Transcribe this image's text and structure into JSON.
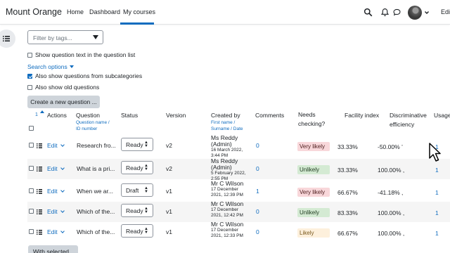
{
  "nav": {
    "brand": "Mount Orange",
    "links": [
      "Home",
      "Dashboard",
      "My courses"
    ],
    "edit_mode": "Edi"
  },
  "filter": {
    "tags_placeholder": "Filter by tags...",
    "show_text": "Show question text in the question list",
    "search_options": "Search options",
    "subcategories": "Also show questions from subcategories",
    "old_questions": "Also show old questions",
    "create_button": "Create a new question ..."
  },
  "table": {
    "headers": {
      "sort_num": "1",
      "actions": "Actions",
      "question": "Question",
      "question_sub": "Question name /",
      "question_sub2": "ID number",
      "status": "Status",
      "version": "Version",
      "created": "Created by",
      "created_sub1": "First name /",
      "created_sub2": "Surname / Date",
      "comments": "Comments",
      "needs1": "Needs",
      "needs2": "checking?",
      "facility": "Facility index",
      "disc1": "Discriminative",
      "disc2": "efficiency",
      "usage": "Usage"
    },
    "rows": [
      {
        "edit": "Edit",
        "question": "Research fro...",
        "status": "Ready",
        "version": "v2",
        "creator1": "Ms Reddy",
        "creator2": "(Admin)",
        "date1": "16 March 2022,",
        "date2": "3:44 PM",
        "comments": "0",
        "needs": "Very likely",
        "facility": "33.33%",
        "disc": "-50.00% ’",
        "usage": "1"
      },
      {
        "edit": "Edit",
        "question": "What is a pri...",
        "status": "Ready",
        "version": "v2",
        "creator1": "Ms Reddy",
        "creator2": "(Admin)",
        "date1": "5 February 2022,",
        "date2": "2:55 PM",
        "comments": "0",
        "needs": "Unlikely",
        "facility": "33.33%",
        "disc": "100.00% ,",
        "usage": "1"
      },
      {
        "edit": "Edit",
        "question": "When we ar...",
        "status": "Draft",
        "version": "v1",
        "creator1": "Mr C Wilson",
        "creator2": "",
        "date1": "17 December",
        "date2": "2021, 12:39 PM",
        "comments": "1",
        "needs": "Very likely",
        "facility": "66.67%",
        "disc": "-41.18% ,",
        "usage": "1"
      },
      {
        "edit": "Edit",
        "question": "Which of the...",
        "status": "Ready",
        "version": "v1",
        "creator1": "Mr C Wilson",
        "creator2": "",
        "date1": "17 December",
        "date2": "2021, 12:42 PM",
        "comments": "0",
        "needs": "Unlikely",
        "facility": "83.33%",
        "disc": "100.00% ,",
        "usage": "1"
      },
      {
        "edit": "Edit",
        "question": "Which of the...",
        "status": "Ready",
        "version": "v1",
        "creator1": "Mr C Wilson",
        "creator2": "",
        "date1": "17 December",
        "date2": "2021, 12:33 PM",
        "comments": "0",
        "needs": "Likely",
        "facility": "66.67%",
        "disc": "100.00% ,",
        "usage": "1"
      }
    ]
  },
  "with_selected": "With selected",
  "colors": {
    "link": "#0f6cbf",
    "very_likely": "#f8d7da",
    "unlikely": "#d4ead3",
    "likely": "#fdf0dc"
  }
}
